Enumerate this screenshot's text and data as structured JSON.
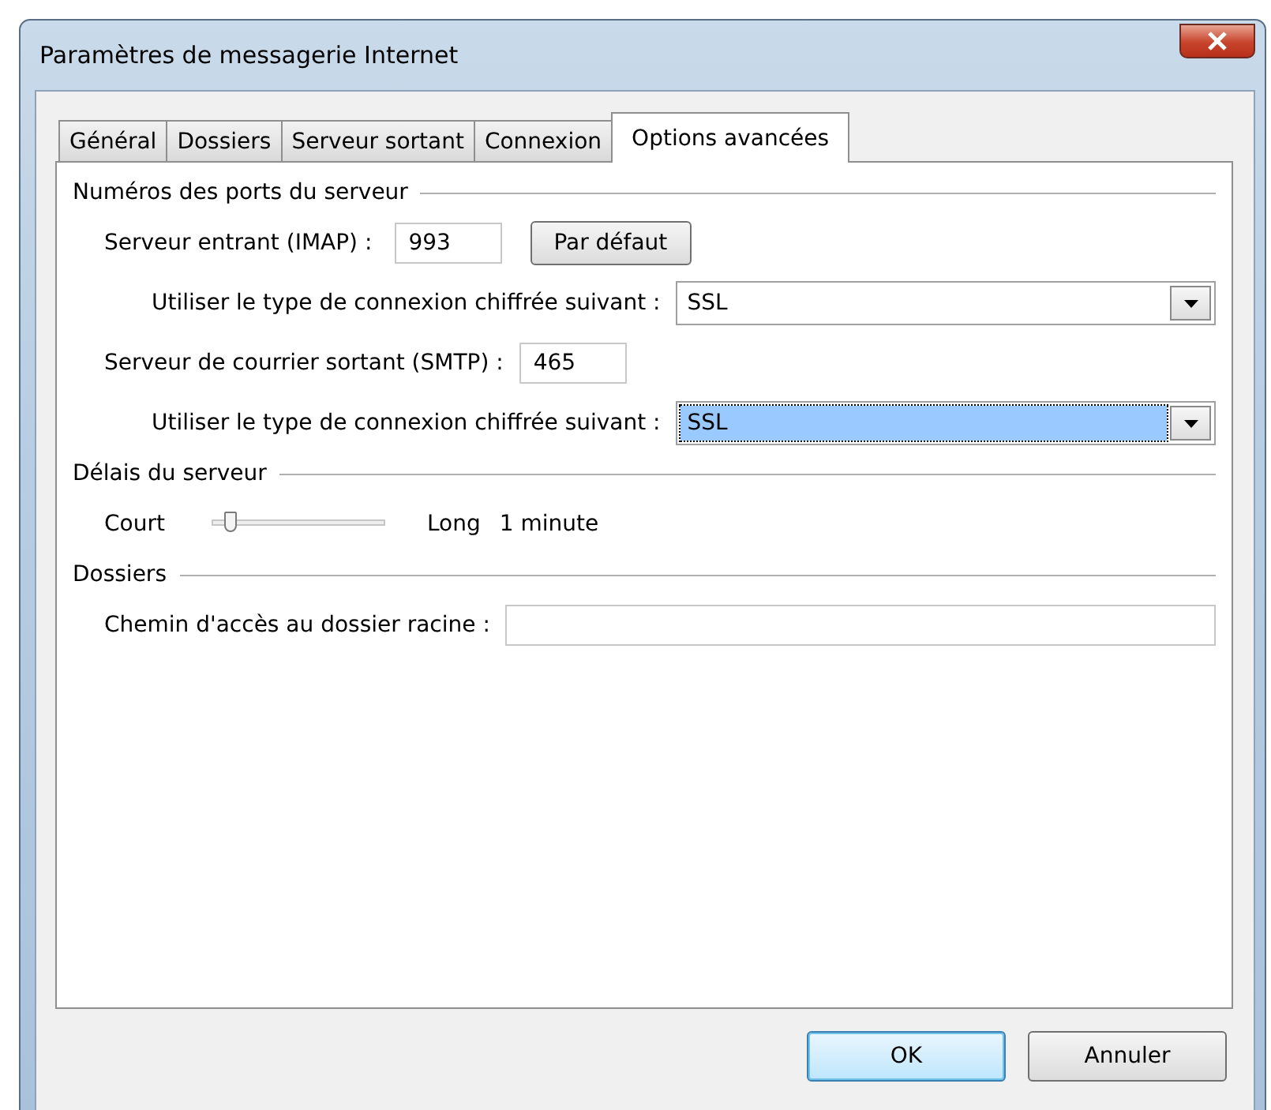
{
  "window": {
    "title": "Paramètres de messagerie Internet"
  },
  "tabs": [
    {
      "label": "Général",
      "selected": false
    },
    {
      "label": "Dossiers",
      "selected": false
    },
    {
      "label": "Serveur sortant",
      "selected": false
    },
    {
      "label": "Connexion",
      "selected": false
    },
    {
      "label": "Options avancées",
      "selected": true
    }
  ],
  "ports": {
    "title": "Numéros des ports du serveur",
    "incoming": {
      "label": "Serveur entrant (IMAP) :",
      "value": "993",
      "default_button": "Par défaut",
      "encryption_label": "Utiliser le type de connexion chiffrée suivant :",
      "encryption": "SSL",
      "highlighted": false
    },
    "outgoing": {
      "label": "Serveur de courrier sortant (SMTP) :",
      "value": "465",
      "encryption_label": "Utiliser le type de connexion chiffrée suivant :",
      "encryption": "SSL",
      "highlighted": true
    }
  },
  "timeout": {
    "title": "Délais du serveur",
    "min_label": "Court",
    "max_label": "Long",
    "level": 0.1,
    "reading": "1 minute"
  },
  "folders": {
    "title": "Dossiers",
    "root_label": "Chemin d'accès au dossier racine :"
  },
  "buttons": [
    {
      "label": "OK",
      "selected": true
    },
    {
      "label": "Annuler",
      "selected": false
    }
  ]
}
